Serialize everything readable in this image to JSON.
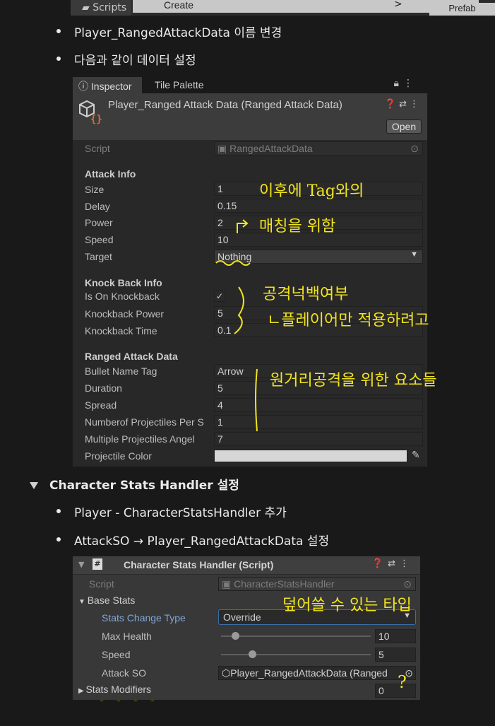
{
  "topbar": {
    "scripts_label": "Scripts",
    "create_label": "Create",
    "arrow": ">",
    "prefab_label": "Prefab"
  },
  "bullets_top": [
    "Player_RangedAttackData 이름 변경",
    "다음과 같이 데이터 설정"
  ],
  "inspector": {
    "tab_inspector": "Inspector",
    "tab_palette": "Tile Palette",
    "title": "Player_Ranged Attack Data (Ranged Attack Data)",
    "open_button": "Open",
    "script_label": "Script",
    "script_value": "RangedAttackData",
    "attack_info": {
      "header": "Attack Info",
      "rows": [
        {
          "label": "Size",
          "value": "1"
        },
        {
          "label": "Delay",
          "value": "0.15"
        },
        {
          "label": "Power",
          "value": "2"
        },
        {
          "label": "Speed",
          "value": "10"
        },
        {
          "label": "Target",
          "value": "Nothing"
        }
      ]
    },
    "knockback_info": {
      "header": "Knock Back Info",
      "is_on_label": "Is On Knockback",
      "is_on_value": "✓",
      "power_label": "Knockback Power",
      "power_value": "5",
      "time_label": "Knockback Time",
      "time_value": "0.1"
    },
    "ranged_data": {
      "header": "Ranged Attack Data",
      "rows": [
        {
          "label": "Bullet Name Tag",
          "value": "Arrow"
        },
        {
          "label": "Duration",
          "value": "5"
        },
        {
          "label": "Spread",
          "value": "4"
        },
        {
          "label": "Numberof Projectiles Per S",
          "value": "1"
        },
        {
          "label": "Multiple Projectiles Angel",
          "value": "7"
        }
      ],
      "color_label": "Projectile Color",
      "color_value": "#d6d6d6"
    }
  },
  "annotations_1": {
    "tag": "이후에 Tag와의",
    "matching": "매칭을 위함",
    "knock": "공격넉백여부",
    "player_only": "ㄴ플레이어만 적용하려고",
    "ranged": "원거리공격을 위한 요소들"
  },
  "section_heading": "Character Stats Handler 설정",
  "bullets_bottom": [
    "Player - CharacterStatsHandler 추가",
    "AttackSO → Player_RangedAttackData 설정"
  ],
  "stats_handler": {
    "title": "Character Stats Handler (Script)",
    "script_label": "Script",
    "script_value": "CharacterStatsHandler",
    "base_stats": "Base Stats",
    "change_type_label": "Stats Change Type",
    "change_type_value": "Override",
    "max_health_label": "Max Health",
    "max_health_value": "10",
    "speed_label": "Speed",
    "speed_value": "5",
    "attack_so_label": "Attack SO",
    "attack_so_value": "Player_RangedAttackData (Ranged",
    "modifiers_label": "Stats Modifiers",
    "modifiers_value": "0"
  },
  "annotations_2": {
    "override": "덮어쓸 수 있는 타입",
    "question": "?"
  },
  "colors": {
    "background": "#191919",
    "panel": "#282828",
    "highlight_yellow": "#f2e41c"
  }
}
